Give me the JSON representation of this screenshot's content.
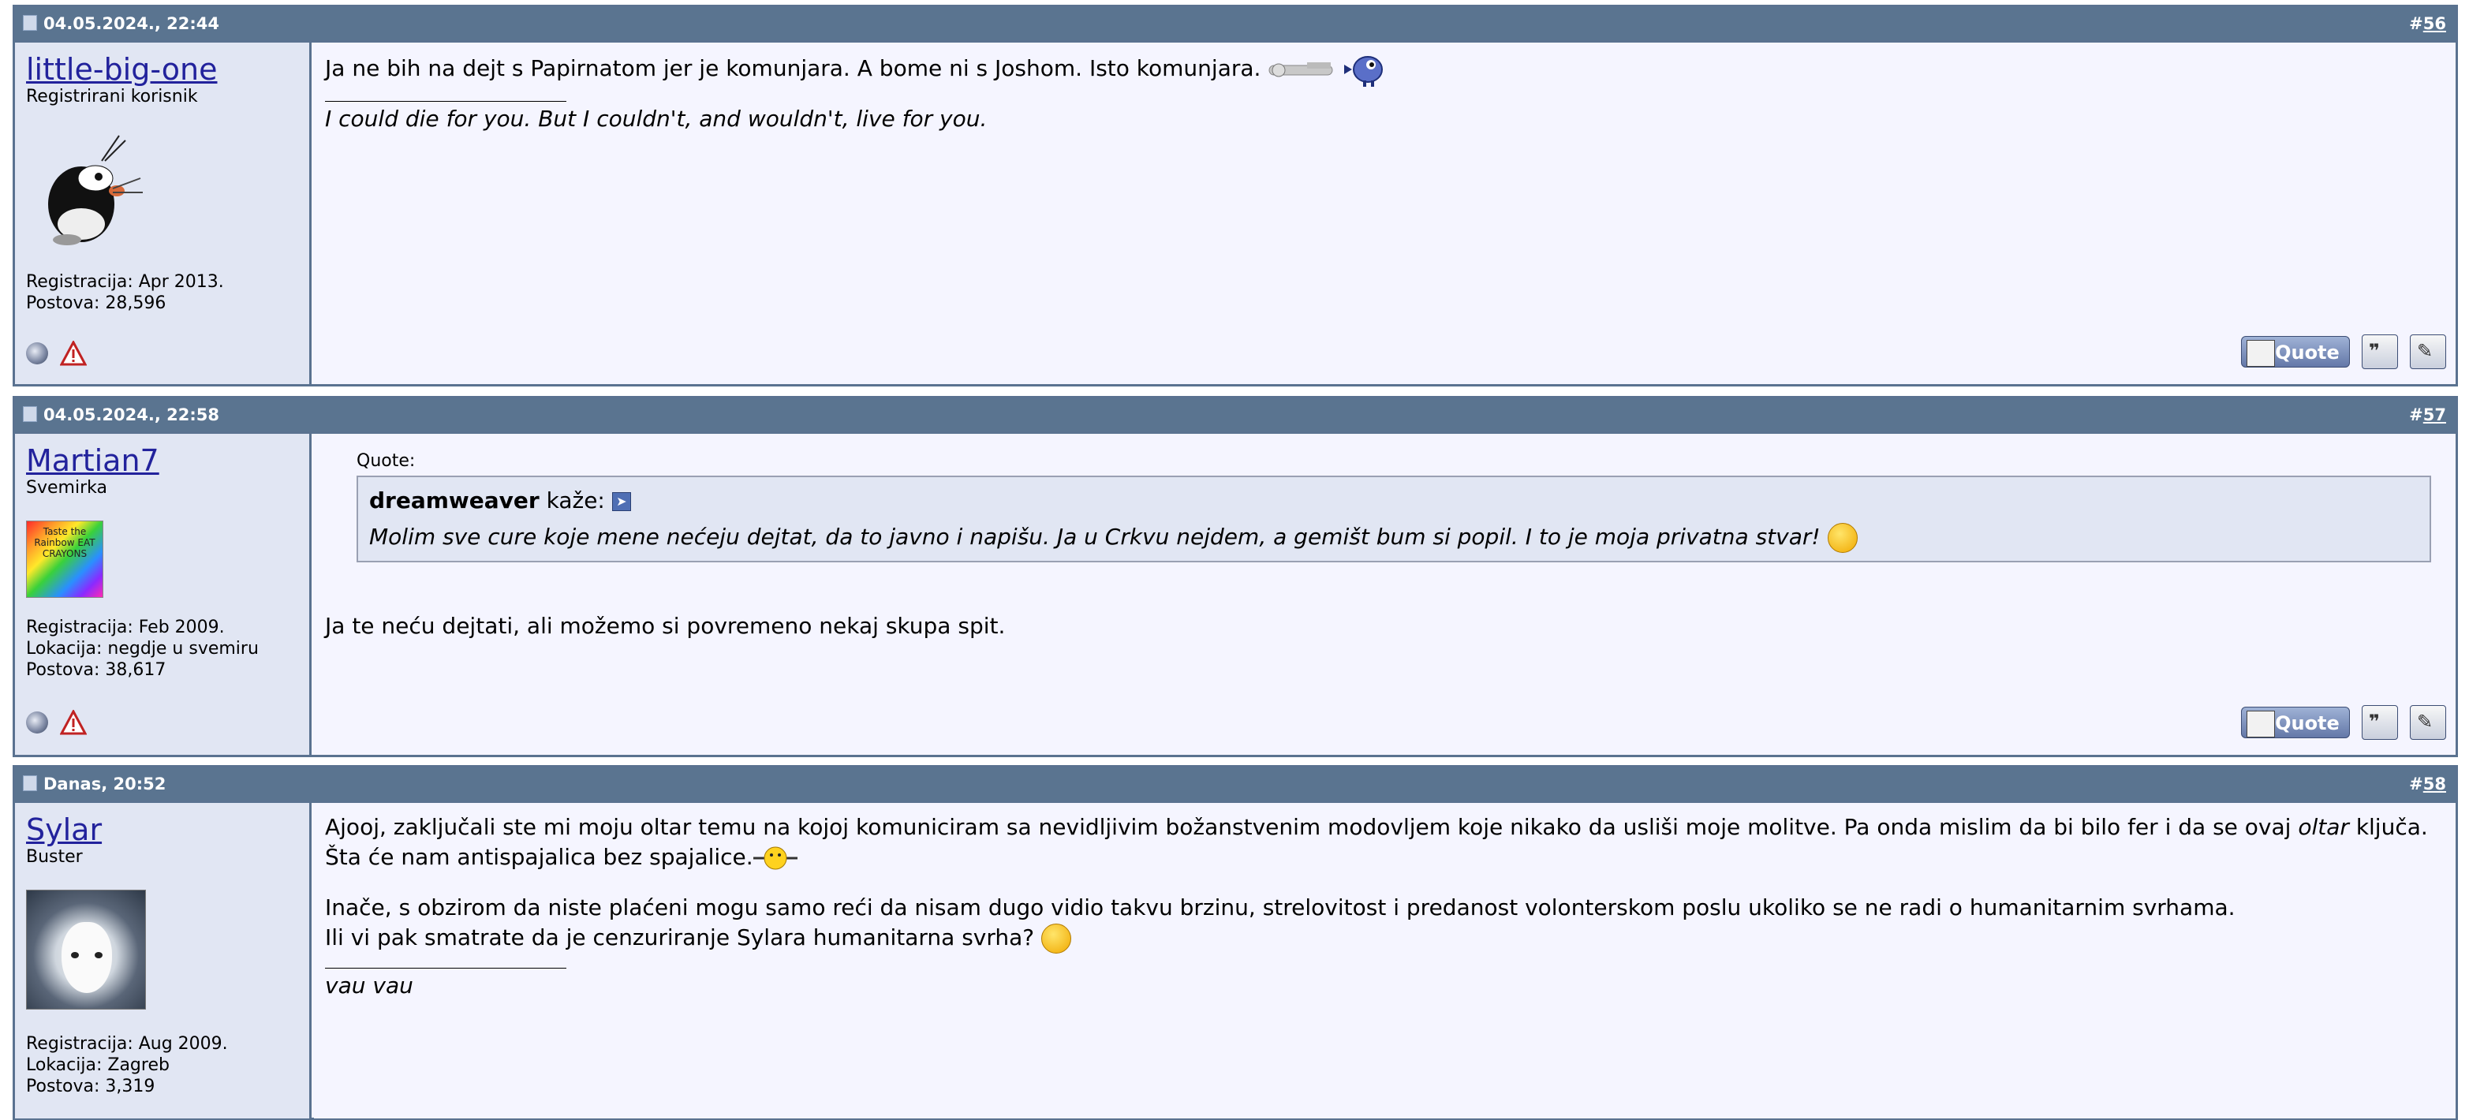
{
  "posts": [
    {
      "date": "04.05.2024., 22:44",
      "number_prefix": "#",
      "number": "56",
      "user": {
        "name": "little-big-one",
        "title": "Registrirani korisnik",
        "avatar_icon": "mole-avatar",
        "stats": [
          "Registracija: Apr 2013.",
          "Postova: 28,596"
        ]
      },
      "message": "Ja ne bih na dejt s Papirnatom jer je komunjara. A bome ni s Joshom. Isto komunjara.",
      "signature": "I could die for you. But I couldn't, and wouldn't, live for you."
    },
    {
      "date": "04.05.2024., 22:58",
      "number_prefix": "#",
      "number": "57",
      "user": {
        "name": "Martian7",
        "title": "Svemirka",
        "avatar_icon": "rainbow-avatar",
        "avatar_text": "Taste the Rainbow EAT CRAYONS",
        "stats": [
          "Registracija: Feb 2009.",
          "Lokacija: negdje u svemiru",
          "Postova: 38,617"
        ]
      },
      "quote": {
        "label": "Quote:",
        "author": "dreamweaver",
        "says": "kaže:",
        "text": "Molim sve cure koje mene nećeju dejtat, da to javno i napišu. Ja u Crkvu nejdem, a gemišt bum si popil. I to je moja privatna stvar!"
      },
      "message": "Ja te neću dejtati, ali možemo si povremeno nekaj skupa spit."
    },
    {
      "date": "Danas, 20:52",
      "number_prefix": "#",
      "number": "58",
      "user": {
        "name": "Sylar",
        "title": "Buster",
        "avatar_icon": "husky-avatar",
        "stats": [
          "Registracija: Aug 2009.",
          "Lokacija: Zagreb",
          "Postova: 3,319"
        ]
      },
      "message_part1": "Ajooj, zaključali ste mi moju oltar temu na kojoj komuniciram sa nevidljivim božanstvenim modovljem koje nikako da usliši moje molitve. Pa onda mislim da bi bilo fer i da se ovaj",
      "message_italic": "oltar",
      "message_part2": "ključa. Šta će nam antispajalica bez spajalice.",
      "message_line2": "Inače, s obzirom da niste plaćeni mogu samo reći da nisam dugo vidio takvu brzinu, strelovitost i predanost volonterskom poslu ukoliko se ne radi o humanitarnim svrhama.",
      "message_line3": "Ili vi pak smatrate da je cenzuriranje Sylara humanitarna svrha?",
      "signature": "vau vau"
    }
  ],
  "buttons": {
    "quote_label": "Quote"
  },
  "colors": {
    "header_bg": "#5a7490",
    "user_col_bg": "#e1e6f3",
    "msg_bg": "#f5f5ff",
    "username": "#22229c"
  }
}
